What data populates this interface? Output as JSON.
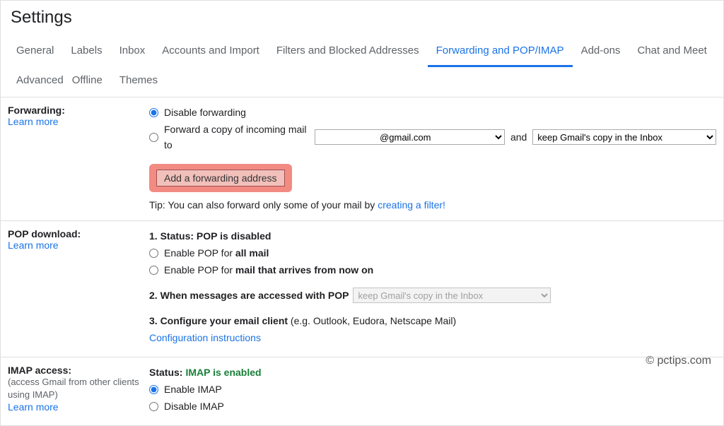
{
  "heading": "Settings",
  "tabs": [
    {
      "label": "General",
      "active": false
    },
    {
      "label": "Labels",
      "active": false
    },
    {
      "label": "Inbox",
      "active": false
    },
    {
      "label": "Accounts and Import",
      "active": false
    },
    {
      "label": "Filters and Blocked Addresses",
      "active": false
    },
    {
      "label": "Forwarding and POP/IMAP",
      "active": true
    },
    {
      "label": "Add-ons",
      "active": false
    },
    {
      "label": "Chat and Meet",
      "active": false
    },
    {
      "label": "Advanced",
      "active": false
    },
    {
      "label": "Offline",
      "active": false
    },
    {
      "label": "Themes",
      "active": false
    }
  ],
  "forwarding": {
    "title": "Forwarding:",
    "learn_more": "Learn more",
    "option_disable": "Disable forwarding",
    "option_forward_prefix": "Forward a copy of incoming mail to",
    "address_selected": "@gmail.com",
    "and_word": "and",
    "action_selected": "keep Gmail's copy in the Inbox",
    "add_button": "Add a forwarding address",
    "tip_prefix": "Tip: You can also forward only some of your mail by ",
    "tip_link": "creating a filter!"
  },
  "pop": {
    "title": "POP download:",
    "learn_more": "Learn more",
    "line1_prefix": "1. Status: ",
    "line1_bold": "POP is disabled",
    "opt_all_prefix": "Enable POP for ",
    "opt_all_bold": "all mail",
    "opt_now_prefix": "Enable POP for ",
    "opt_now_bold": "mail that arrives from now on",
    "line2_bold": "2. When messages are accessed with POP",
    "line2_action_selected": "keep Gmail's copy in the Inbox",
    "line3_bold": "3. Configure your email client",
    "line3_rest": " (e.g. Outlook, Eudora, Netscape Mail)",
    "config_link": "Configuration instructions"
  },
  "imap": {
    "title": "IMAP access:",
    "sub": "(access Gmail from other clients using IMAP)",
    "learn_more": "Learn more",
    "status_prefix": "Status: ",
    "status_value": "IMAP is enabled",
    "opt_enable": "Enable IMAP",
    "opt_disable": "Disable IMAP"
  },
  "watermark": "© pctips.com"
}
